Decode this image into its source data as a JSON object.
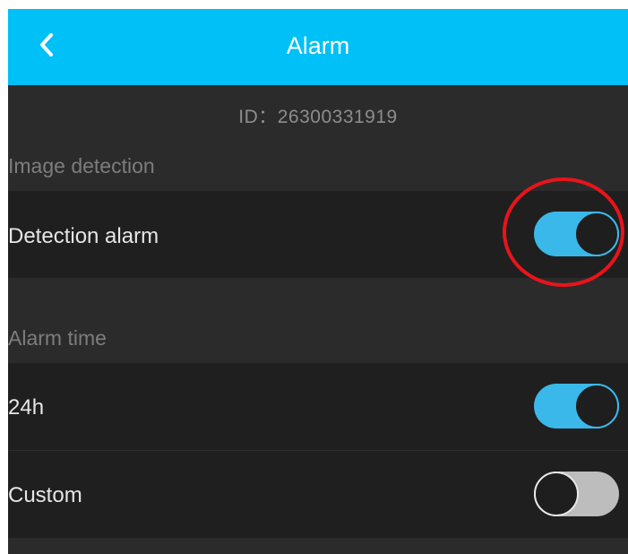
{
  "header": {
    "title": "Alarm",
    "background_color": "#00c0f8"
  },
  "device": {
    "id_text": "ID：26300331919"
  },
  "sections": [
    {
      "label": "Image detection",
      "rows": [
        {
          "label": "Detection alarm",
          "toggle_on": true
        }
      ]
    },
    {
      "label": "Alarm time",
      "rows": [
        {
          "label": "24h",
          "toggle_on": true
        },
        {
          "label": "Custom",
          "toggle_on": false
        }
      ]
    }
  ],
  "annotation": {
    "highlight_color": "#e8141b",
    "highlighted_control": "Detection alarm toggle"
  },
  "colors": {
    "toggle_on": "#3bb8ea",
    "toggle_off": "#bdbdbd",
    "background": "#2b2b2b",
    "row_background": "#1f1f1f"
  },
  "icons": {
    "back": "chevron-left-icon"
  }
}
